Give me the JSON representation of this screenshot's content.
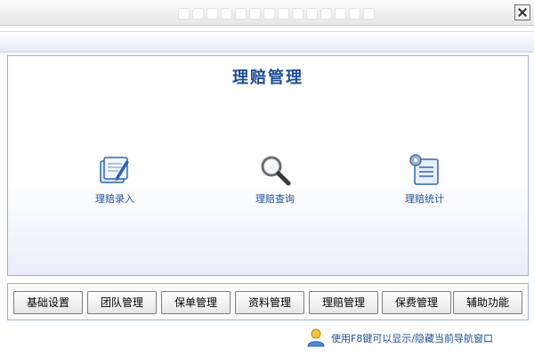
{
  "window": {
    "close_icon": "close-icon"
  },
  "panel": {
    "title": "理赔管理",
    "features": [
      {
        "label": "理赔录入",
        "icon": "document-pen-icon"
      },
      {
        "label": "理赔查询",
        "icon": "magnifier-icon"
      },
      {
        "label": "理赔统计",
        "icon": "statistics-gear-icon"
      }
    ]
  },
  "nav": {
    "buttons": [
      "基础设置",
      "团队管理",
      "保单管理",
      "资料管理",
      "理赔管理",
      "保费管理",
      "辅助功能"
    ]
  },
  "hint": {
    "text": "使用F8键可以显示/隐藏当前导航窗口",
    "icon": "user-icon"
  },
  "colors": {
    "accent": "#1d4d99",
    "border": "#9fb2d4"
  }
}
